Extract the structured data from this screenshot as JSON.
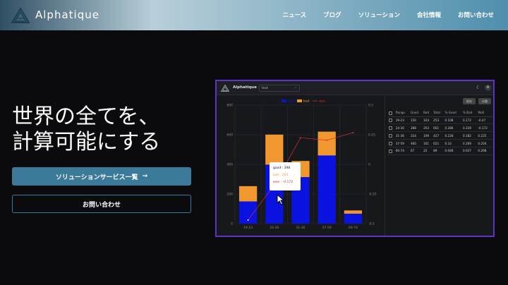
{
  "header": {
    "brand": "Alphatique",
    "nav": [
      "ニュース",
      "ブログ",
      "ソリューション",
      "会社情報",
      "お問い合わせ"
    ]
  },
  "hero": {
    "title_line1": "世界の全てを、",
    "title_line2": "計算可能にする",
    "primary_button": "ソリューションサービス一覧",
    "primary_arrow": "→",
    "secondary_button": "お問い合わせ"
  },
  "panel": {
    "brand": "Alphatique",
    "dataset": "test",
    "buttons": [
      "保存",
      "分散"
    ],
    "table": {
      "headers": [
        "",
        "Range",
        "Good",
        "Bad",
        "Total",
        "% Good",
        "% Bad",
        "WoE"
      ],
      "rows": [
        [
          "19-23",
          "150",
          "103",
          "253",
          "0.108",
          "0.172",
          "-0.47"
        ],
        [
          "24-30",
          "398",
          "203",
          "601",
          "0.286",
          "0.339",
          "-0.172"
        ],
        [
          "31-36",
          "314",
          "109",
          "427",
          "0.228",
          "0.182",
          "0.225"
        ],
        [
          "37-59",
          "460",
          "161",
          "621",
          "0.33",
          "0.269",
          "0.204"
        ],
        [
          "60-74",
          "67",
          "22",
          "89",
          "0.048",
          "0.037",
          "0.268"
        ]
      ]
    },
    "tooltip": {
      "good": "good : 398",
      "bad": "bad : 203",
      "woe": "woe : -0.172"
    }
  },
  "chart_data": {
    "type": "bar",
    "categories": [
      "19-23",
      "24-30",
      "31-36",
      "37-59",
      "60-74"
    ],
    "series": [
      {
        "name": "good",
        "values": [
          150,
          398,
          314,
          460,
          67
        ],
        "color": "#0a12e0"
      },
      {
        "name": "bad",
        "values": [
          103,
          203,
          109,
          161,
          22
        ],
        "color": "#f0982f"
      },
      {
        "name": "woe",
        "type": "line",
        "axis": "right",
        "values": [
          -0.47,
          -0.172,
          0.225,
          0.204,
          0.268
        ],
        "color": "#d23030"
      }
    ],
    "ylim": [
      0,
      800
    ],
    "yticks": [
      "0",
      "200",
      "400",
      "600",
      "800"
    ],
    "y2lim": [
      -0.5,
      0.5
    ],
    "y2ticks": [
      "-0.5",
      "-0.25",
      "0",
      "0.25",
      "0.5"
    ],
    "legend_labels": [
      "good",
      "bad",
      "woe"
    ],
    "legend": "top",
    "grid": true
  },
  "colors": {
    "accent": "#3c7a9a",
    "panel_border": "#5b33c7"
  }
}
